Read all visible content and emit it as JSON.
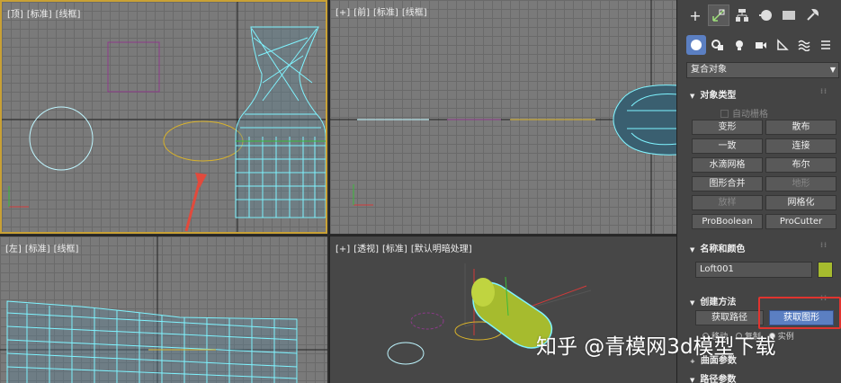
{
  "viewports": {
    "top": {
      "labels": [
        "[顶]",
        "[标准]",
        "[线框]"
      ]
    },
    "front": {
      "labels": [
        "[+]",
        "[前]",
        "[标准]",
        "[线框]"
      ]
    },
    "left": {
      "labels": [
        "[左]",
        "[标准]",
        "[线框]"
      ]
    },
    "persp": {
      "labels": [
        "[+]",
        "[透视]",
        "[标准]",
        "[默认明暗处理]"
      ]
    },
    "active": "top"
  },
  "command_panel": {
    "tabs": [
      "create-icon",
      "modify-icon",
      "hierarchy-icon",
      "motion-icon",
      "display-icon",
      "utilities-icon"
    ],
    "create_categories": [
      "geometry-icon",
      "shapes-icon",
      "lights-icon",
      "cameras-icon",
      "helpers-icon",
      "spacewarps-icon",
      "systems-icon"
    ],
    "category_dropdown": "复合对象",
    "object_type": {
      "title": "对象类型",
      "auto_grid": "自动栅格",
      "buttons": [
        {
          "label": "变形",
          "enabled": true
        },
        {
          "label": "散布",
          "enabled": true
        },
        {
          "label": "一致",
          "enabled": true
        },
        {
          "label": "连接",
          "enabled": true
        },
        {
          "label": "水滴网格",
          "enabled": true
        },
        {
          "label": "布尔",
          "enabled": true
        },
        {
          "label": "图形合并",
          "enabled": true
        },
        {
          "label": "地形",
          "enabled": false
        },
        {
          "label": "放样",
          "enabled": false
        },
        {
          "label": "网格化",
          "enabled": true
        },
        {
          "label": "ProBoolean",
          "enabled": true
        },
        {
          "label": "ProCutter",
          "enabled": true
        }
      ]
    },
    "name_and_color": {
      "title": "名称和颜色",
      "name": "Loft001",
      "color": "#a6bb2e"
    },
    "creation_method": {
      "title": "创建方法",
      "get_path": "获取路径",
      "get_shape": "获取图形",
      "radio": [
        "移动",
        "复制",
        "实例"
      ],
      "radio_selected": 2
    },
    "surface_params_title": "曲面参数",
    "path_params_title": "路径参数"
  },
  "colors": {
    "accent_active": "#5b7fc2",
    "active_viewport_border": "#c9a135",
    "annotation_red": "#e0342f",
    "wire_cyan": "#7ff4ff"
  },
  "watermark": "知乎 @青模网3d模型下载"
}
